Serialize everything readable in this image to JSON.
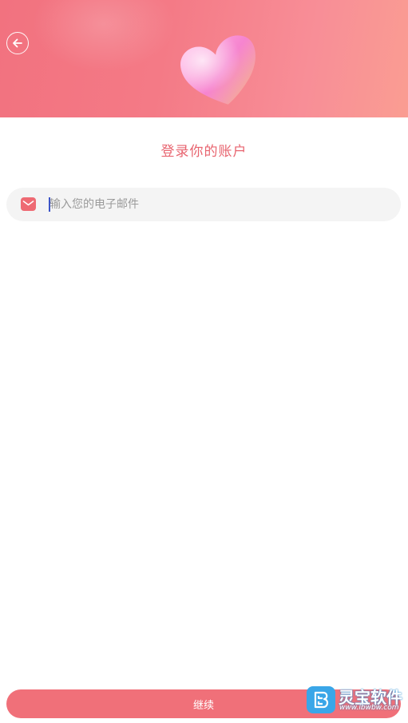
{
  "header": {
    "back_icon": "arrow-left-icon",
    "hero_image": "heart-icon"
  },
  "page": {
    "title": "登录你的账户"
  },
  "email": {
    "icon": "mail-icon",
    "placeholder": "输入您的电子邮件",
    "value": ""
  },
  "actions": {
    "continue_label": "继续"
  },
  "watermark": {
    "brand": "灵宝软件",
    "url": "www.lbwbw.com"
  },
  "colors": {
    "accent": "#f07079",
    "title": "#e8646f",
    "field_bg": "#f4f4f4"
  }
}
